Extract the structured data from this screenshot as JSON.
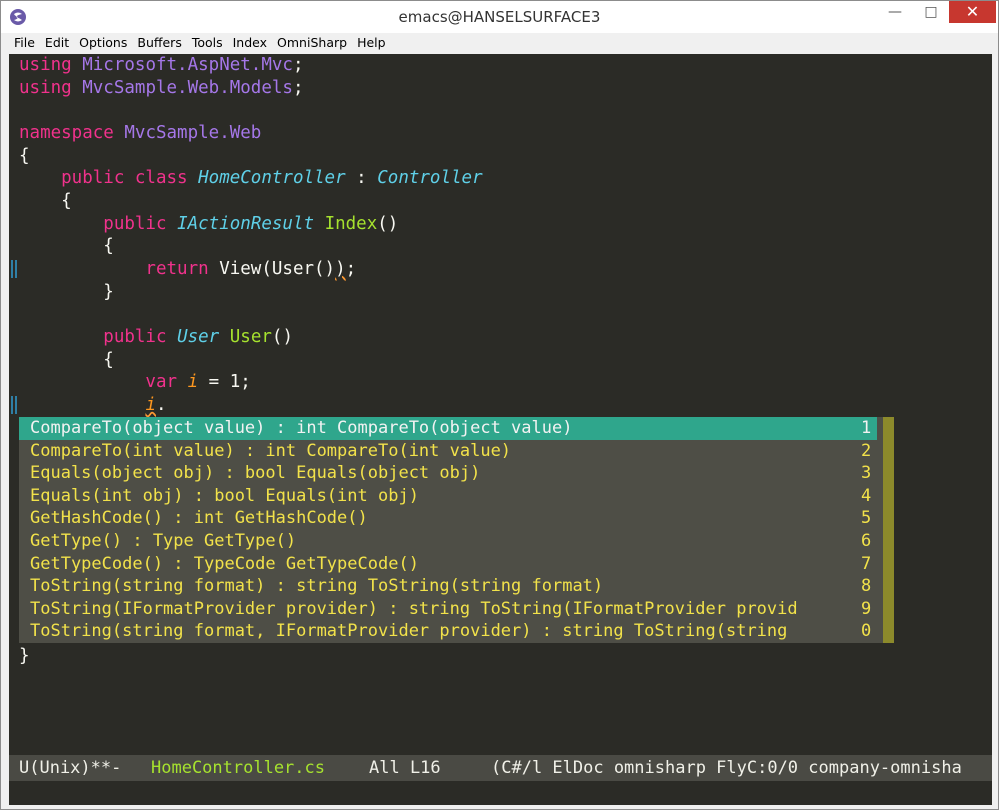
{
  "window": {
    "title": "emacs@HANSELSURFACE3",
    "minimize": "—",
    "maximize": "□",
    "close": "✕"
  },
  "menu": [
    "File",
    "Edit",
    "Options",
    "Buffers",
    "Tools",
    "Index",
    "OmniSharp",
    "Help"
  ],
  "code": {
    "l1_kw": "using",
    "l1_ns": "Microsoft.AspNet.Mvc",
    "l1_end": ";",
    "l2_kw": "using",
    "l2_ns": "MvcSample.Web.Models",
    "l2_end": ";",
    "l4_kw": "namespace",
    "l4_ns": "MvcSample.Web",
    "l5": "{",
    "l6_kw": "    public class",
    "l6_type": "HomeController",
    "l6_sep": " : ",
    "l6_base": "Controller",
    "l7": "    {",
    "l8_kw": "        public",
    "l8_type": "IActionResult",
    "l8_fn": "Index",
    "l8_end": "()",
    "l9": "        {",
    "l10_kw": "            return",
    "l10_rest": " View(User()",
    "l10_squig": ")",
    "l10_end": ";",
    "l11": "        }",
    "l13_kw": "        public",
    "l13_type": "User",
    "l13_fn": "User",
    "l13_end": "()",
    "l14": "        {",
    "l15_kw": "            var",
    "l15_var": "i",
    "l15_rest": " = 1;",
    "l16_indent": "            ",
    "l16_var": "i",
    "l16_dot": ".",
    "l28": "}"
  },
  "completions": [
    {
      "text": "CompareTo(object value) : int CompareTo(object value)",
      "num": "1"
    },
    {
      "text": "CompareTo(int value) : int CompareTo(int value)",
      "num": "2"
    },
    {
      "text": "Equals(object obj) : bool Equals(object obj)",
      "num": "3"
    },
    {
      "text": "Equals(int obj) : bool Equals(int obj)",
      "num": "4"
    },
    {
      "text": "GetHashCode() : int GetHashCode()",
      "num": "5"
    },
    {
      "text": "GetType() : Type GetType()",
      "num": "6"
    },
    {
      "text": "GetTypeCode() : TypeCode GetTypeCode()",
      "num": "7"
    },
    {
      "text": "ToString(string format) : string ToString(string format)",
      "num": "8"
    },
    {
      "text": "ToString(IFormatProvider provider) : string ToString(IFormatProvider provid",
      "num": "9"
    },
    {
      "text": "ToString(string format, IFormatProvider provider) : string ToString(string",
      "num": "0"
    }
  ],
  "modeline": {
    "status": "U(Unix)**-",
    "buffer": "HomeController.cs",
    "position": "All L16",
    "modes": "(C#/l ElDoc omnisharp FlyC:0/0 company-omnisha"
  }
}
